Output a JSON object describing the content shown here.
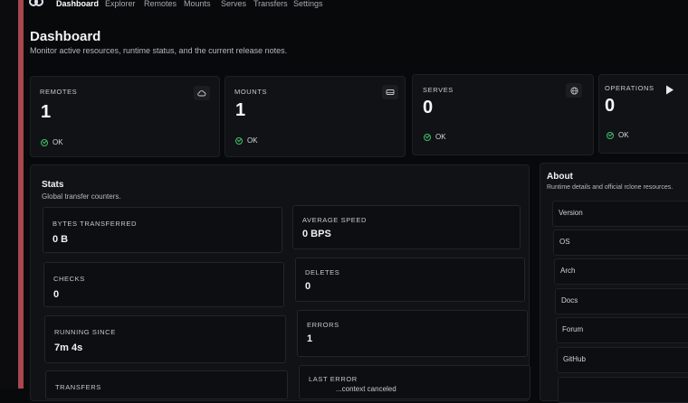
{
  "nav": {
    "items": [
      "Dashboard",
      "Explorer",
      "Remotes",
      "Mounts",
      "Serves",
      "Transfers",
      "Settings"
    ],
    "active": "Dashboard"
  },
  "page": {
    "title": "Dashboard",
    "subtitle": "Monitor active resources, runtime status, and the current release notes."
  },
  "summary": [
    {
      "label": "REMOTES",
      "value": "1",
      "status": "OK",
      "icon": "cloud-icon"
    },
    {
      "label": "MOUNTS",
      "value": "1",
      "status": "OK",
      "icon": "drive-icon"
    },
    {
      "label": "SERVES",
      "value": "0",
      "status": "OK",
      "icon": "globe-icon"
    },
    {
      "label": "OPERATIONS",
      "value": "0",
      "status": "OK",
      "icon": "play-icon"
    }
  ],
  "stats": {
    "title": "Stats",
    "subtitle": "Global transfer counters.",
    "metrics": [
      {
        "label": "BYTES TRANSFERRED",
        "value": "0 B"
      },
      {
        "label": "AVERAGE SPEED",
        "value": "0 BPS"
      },
      {
        "label": "CHECKS",
        "value": "0"
      },
      {
        "label": "DELETES",
        "value": "0"
      },
      {
        "label": "RUNNING SINCE",
        "value": "7m 4s"
      },
      {
        "label": "ERRORS",
        "value": "1"
      },
      {
        "label": "TRANSFERS",
        "value": ""
      },
      {
        "label": "LAST ERROR",
        "value": "...context canceled"
      }
    ]
  },
  "about": {
    "title": "About",
    "subtitle": "Runtime details and official rclone resources.",
    "rows": [
      "Version",
      "OS",
      "Arch",
      "Docs",
      "Forum",
      "GitHub"
    ]
  },
  "colors": {
    "background": "#08090b",
    "card": "#111215",
    "ok_green": "#3fbf6a",
    "edge_red": "#a8484e"
  }
}
